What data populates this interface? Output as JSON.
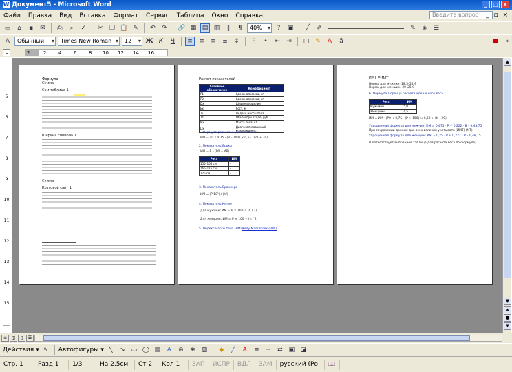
{
  "window": {
    "title": "Документ5 - Microsoft Word"
  },
  "menu": {
    "items": [
      "Файл",
      "Правка",
      "Вид",
      "Вставка",
      "Формат",
      "Сервис",
      "Таблица",
      "Окно",
      "Справка"
    ],
    "help_placeholder": "Введите вопрос"
  },
  "toolbar": {
    "zoom": "40%",
    "style": "Обычный",
    "font": "Times New Roman",
    "size": "12",
    "bold": "Ж",
    "italic": "К",
    "underline": "Ч"
  },
  "ruler": {
    "ticks": [
      "2",
      "2",
      "4",
      "6",
      "8",
      "10",
      "12",
      "14",
      "16"
    ]
  },
  "vruler": {
    "ticks": [
      "5",
      "6",
      "7",
      "8",
      "9",
      "10",
      "11",
      "12",
      "13",
      "14",
      "15"
    ]
  },
  "page1": {
    "lines": [
      "Формула",
      "Сумма",
      "Сем таблица 1",
      "Ширина символа 1",
      "Сумма",
      "Круговой сайт 1"
    ]
  },
  "page2": {
    "heading": "Расчет показателей",
    "table_headers": [
      "Условное обозначение",
      "Коэффициент"
    ],
    "table_rows": [
      [
        "P1",
        "Удельная масса, кг"
      ],
      [
        "P2",
        "Удельная масса, кг"
      ],
      [
        "Dx",
        "Ширина изделия"
      ],
      [
        "Ex",
        "Рост, м"
      ],
      [
        "Ty",
        "Индекс массы тела"
      ],
      [
        "Tz",
        "Объем при входе, руб"
      ],
      [
        "Mx",
        "Масса тела, кг"
      ],
      [
        "Dx",
        "Диагонализованный коэффициент"
      ]
    ],
    "item1": "1. Формула расчета индексного веса",
    "formula1": "ИМ = 10 х 0.75 · (P – 100) × 0,5 · (1/P + 30)",
    "item2": "2. Показатель Брока",
    "formula2": "ИМ = P – (Р0 + ΔP)",
    "small_table_headers": [
      "Рост",
      "ИМ"
    ],
    "small_table_rows": [
      [
        "155–165 см",
        "–"
      ],
      [
        "165–175 см",
        "–"
      ],
      [
        "175 см",
        "–"
      ]
    ],
    "item3": "3. Показатель Бронкера",
    "item4": "4. Показатель Кетле",
    "formula4a": "Для мужчин: ИМ = P × 100 ÷ (h / 2)",
    "formula4b": "Для женщин: ИМ = P × 100 ÷ (h / 2)",
    "item5": "5. Индекс массы тела (ИМТ) –",
    "link": "Body Mass Index (BMI)"
  },
  "page3": {
    "header": "ИМТ = м/h²",
    "norm_m": "Норма для мужчин: 18,5–24,9",
    "norm_f": "Норма для женщин: 20–25,9",
    "item6": "6. Формула Лоренца расчета идеального веса",
    "table_headers": [
      "Рост",
      "ИМ"
    ],
    "table_rows": [
      [
        "Мужчины",
        "5,0"
      ],
      [
        "Женщины",
        "4,5"
      ]
    ],
    "formula6": "ИМ = ИМ · (Р0 + 0,75 · (Р + 150) × 0,50 + (h – 20))",
    "calc_male": "Упрощенная формула для мужчин: ИМ = 0,475 · Р + 0,222 · В – 0,48,75",
    "calc_female": "Упрощенная формула для женщин: ИМ = 0,75 · Р + 0,222 · В – 0,48,15",
    "note": "При сохранении данных для всех величин учитывать (ИМТ) (МТ)",
    "last": "(Соответствует выбранной таблице для расчета веса по формуле)"
  },
  "drawbar": {
    "actions": "Действия",
    "autoshapes": "Автофигуры"
  },
  "status": {
    "page": "Стр. 1",
    "section": "Разд 1",
    "pages": "1/3",
    "at": "На 2,5см",
    "line": "Ст 2",
    "col": "Кол 1",
    "rec": "ЗАП",
    "trk": "ИСПР",
    "ext": "ВДЛ",
    "ovr": "ЗАМ",
    "lang": "русский (Ро"
  }
}
